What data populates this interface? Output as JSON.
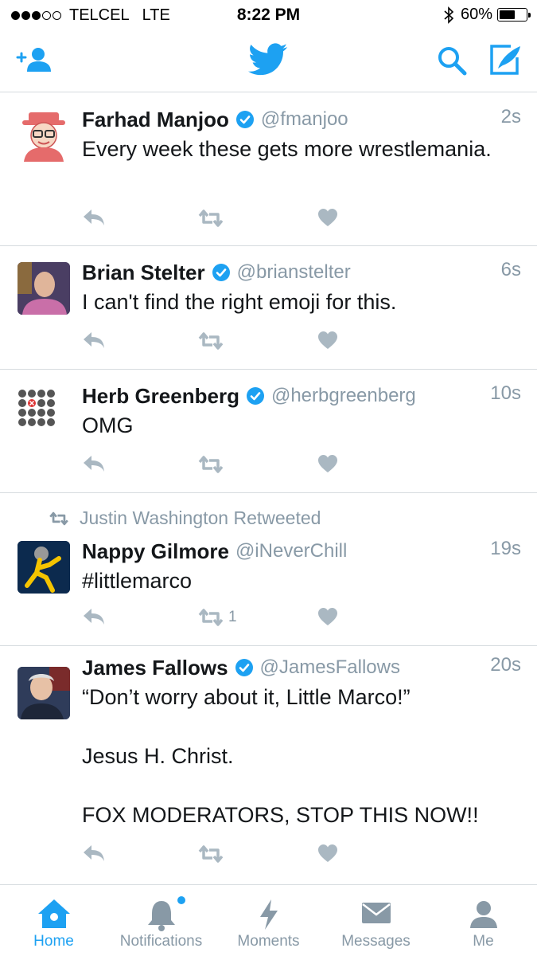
{
  "status_bar": {
    "carrier": "TELCEL",
    "network": "LTE",
    "time": "8:22 PM",
    "battery": "60%",
    "battery_level": 0.6
  },
  "nav": {
    "left_icon": "add-user-icon",
    "center_icon": "twitter-bird-icon",
    "right_icons": [
      "search-icon",
      "compose-icon"
    ]
  },
  "colors": {
    "accent": "#1da1f2",
    "muted": "#8899a6",
    "action_icon": "#aab8c2",
    "text": "#14171a",
    "divider": "#d6dbdf"
  },
  "tweets": [
    {
      "name": "Farhad Manjoo",
      "verified": true,
      "handle": "@fmanjoo",
      "time": "2s",
      "text": "Every week these gets more wrestlemania.",
      "retweet_count": ""
    },
    {
      "name": "Brian Stelter",
      "verified": true,
      "handle": "@brianstelter",
      "time": "6s",
      "text": "I can't find the right emoji for this.",
      "retweet_count": ""
    },
    {
      "name": "Herb Greenberg",
      "verified": true,
      "handle": "@herbgreenberg",
      "time": "10s",
      "text": "OMG",
      "retweet_count": ""
    },
    {
      "retweeted_by": "Justin Washington Retweeted",
      "name": "Nappy Gilmore",
      "verified": false,
      "handle": "@iNeverChill",
      "time": "19s",
      "text": "#littlemarco",
      "retweet_count": "1"
    },
    {
      "name": "James Fallows",
      "verified": true,
      "handle": "@JamesFallows",
      "time": "20s",
      "text": "“Don’t worry about it, Little Marco!”\n\nJesus H. Christ.\n\nFOX MODERATORS, STOP THIS NOW!!",
      "retweet_count": ""
    }
  ],
  "tabs": [
    {
      "label": "Home",
      "icon": "home-icon",
      "active": true
    },
    {
      "label": "Notifications",
      "icon": "bell-icon",
      "active": false
    },
    {
      "label": "Moments",
      "icon": "lightning-icon",
      "active": false
    },
    {
      "label": "Messages",
      "icon": "envelope-icon",
      "active": false
    },
    {
      "label": "Me",
      "icon": "profile-icon",
      "active": false
    }
  ]
}
